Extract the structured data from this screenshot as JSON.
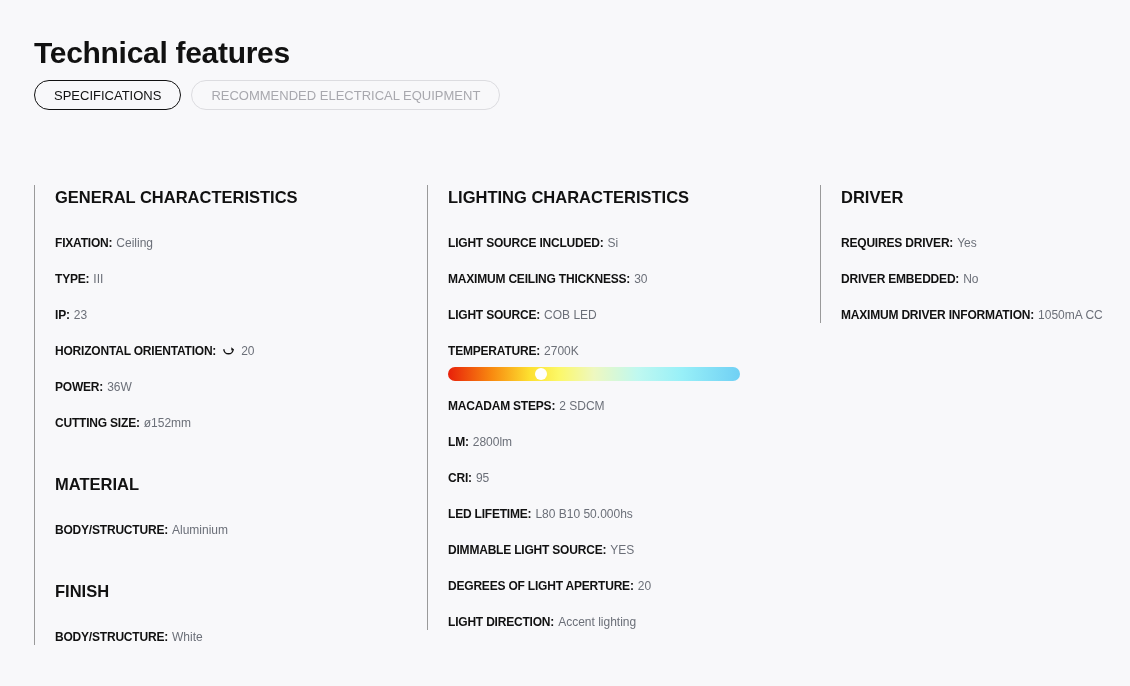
{
  "title": "Technical features",
  "tabs": [
    {
      "label": "SPECIFICATIONS",
      "selected": true
    },
    {
      "label": "RECOMMENDED ELECTRICAL EQUIPMENT",
      "selected": false
    }
  ],
  "columns": [
    {
      "sections": [
        {
          "title": "GENERAL CHARACTERISTICS",
          "items": [
            {
              "kind": "text",
              "label": "FIXATION:",
              "value": "Ceiling"
            },
            {
              "kind": "text",
              "label": "TYPE:",
              "value": "III"
            },
            {
              "kind": "text",
              "label": "IP:",
              "value": "23"
            },
            {
              "kind": "rotation",
              "label": "HORIZONTAL ORIENTATION:",
              "value": "20"
            },
            {
              "kind": "text",
              "label": "POWER:",
              "value": "36W"
            },
            {
              "kind": "text",
              "label": "CUTTING SIZE:",
              "value": "ø152mm"
            }
          ]
        },
        {
          "title": "MATERIAL",
          "items": [
            {
              "kind": "text",
              "label": "BODY/STRUCTURE:",
              "value": "Aluminium"
            }
          ]
        },
        {
          "title": "FINISH",
          "items": [
            {
              "kind": "text",
              "label": "BODY/STRUCTURE:",
              "value": "White"
            }
          ]
        }
      ]
    },
    {
      "sections": [
        {
          "title": "LIGHTING CHARACTERISTICS",
          "items": [
            {
              "kind": "text",
              "label": "LIGHT SOURCE INCLUDED:",
              "value": "Si"
            },
            {
              "kind": "text",
              "label": "MAXIMUM CEILING THICKNESS:",
              "value": "30"
            },
            {
              "kind": "text",
              "label": "LIGHT SOURCE:",
              "value": "COB LED"
            },
            {
              "kind": "temperature",
              "label": "TEMPERATURE:",
              "value": "2700K",
              "level": 0.32
            },
            {
              "kind": "text",
              "label": "MACADAM STEPS:",
              "value": "2 SDCM"
            },
            {
              "kind": "text",
              "label": "LM:",
              "value": "2800lm"
            },
            {
              "kind": "text",
              "label": "CRI:",
              "value": "95"
            },
            {
              "kind": "text",
              "label": "LED LIFETIME:",
              "value": "L80 B10 50.000hs"
            },
            {
              "kind": "text",
              "label": "DIMMABLE LIGHT SOURCE:",
              "value": "YES"
            },
            {
              "kind": "text",
              "label": "DEGREES OF LIGHT APERTURE:",
              "value": "20"
            },
            {
              "kind": "text",
              "label": "LIGHT DIRECTION:",
              "value": "Accent lighting"
            }
          ]
        }
      ]
    },
    {
      "sections": [
        {
          "title": "DRIVER",
          "items": [
            {
              "kind": "text",
              "label": "REQUIRES DRIVER:",
              "value": "Yes"
            },
            {
              "kind": "text",
              "label": "DRIVER EMBEDDED:",
              "value": "No"
            },
            {
              "kind": "text",
              "label": "MAXIMUM DRIVER INFORMATION:",
              "value": "1050mA CC"
            }
          ]
        }
      ]
    }
  ]
}
